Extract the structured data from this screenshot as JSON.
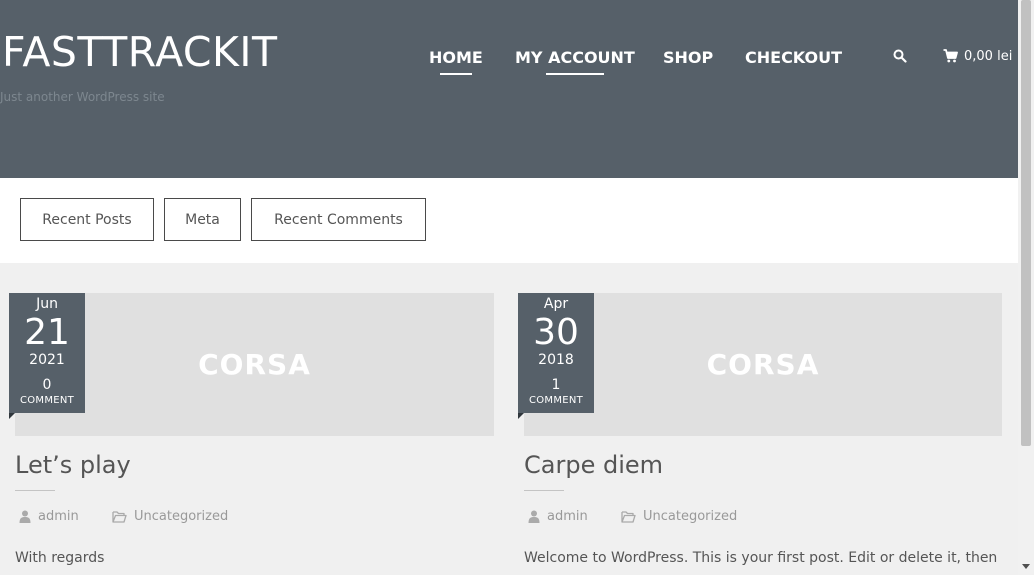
{
  "site": {
    "title": "FASTTRACKIT",
    "tagline": "Just another WordPress site"
  },
  "nav": {
    "items": [
      {
        "label": "HOME",
        "underlined": true
      },
      {
        "label": "MY ACCOUNT",
        "underlined": true
      },
      {
        "label": "SHOP",
        "underlined": false
      },
      {
        "label": "CHECKOUT",
        "underlined": false
      }
    ],
    "search_icon": "search-icon",
    "cart_icon": "cart-icon",
    "cart_total": "0,00 lei"
  },
  "tabs": [
    "Recent Posts",
    "Meta",
    "Recent Comments"
  ],
  "posts": [
    {
      "month": "Jun",
      "day": "21",
      "year": "2021",
      "comment_count": "0",
      "comment_label": "COMMENT",
      "image_text": "CORSA",
      "title": "Let’s play",
      "author": "admin",
      "category": "Uncategorized",
      "excerpt": "With regards"
    },
    {
      "month": "Apr",
      "day": "30",
      "year": "2018",
      "comment_count": "1",
      "comment_label": "COMMENT",
      "image_text": "CORSA",
      "title": "Carpe diem",
      "author": "admin",
      "category": "Uncategorized",
      "excerpt": "Welcome to WordPress. This is your first post. Edit or delete it, then"
    }
  ],
  "colors": {
    "header_bg": "#566069",
    "page_bg": "#f0f0f0",
    "image_placeholder": "#e0e0e0"
  }
}
